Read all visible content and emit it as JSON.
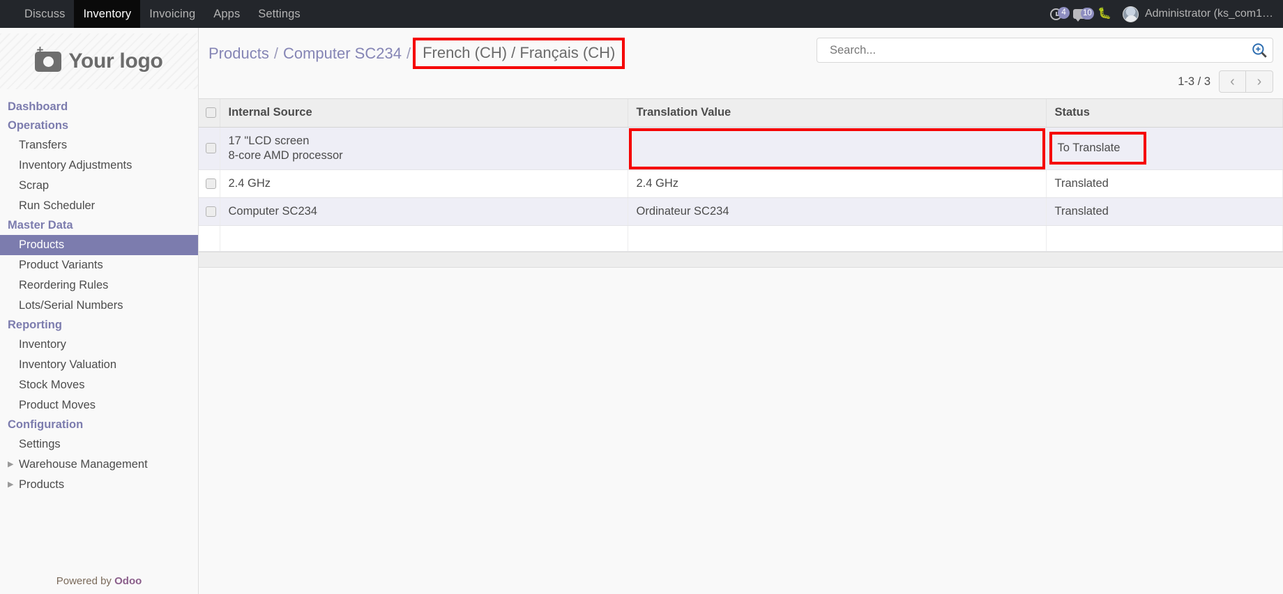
{
  "navbar": {
    "apps": [
      {
        "label": "Discuss",
        "active": false
      },
      {
        "label": "Inventory",
        "active": true
      },
      {
        "label": "Invoicing",
        "active": false
      },
      {
        "label": "Apps",
        "active": false
      },
      {
        "label": "Settings",
        "active": false
      }
    ],
    "activity_badge": "4",
    "messages_badge": "10",
    "debug_icon": "bug-icon",
    "user_name": "Administrator (ks_com1…"
  },
  "sidebar": {
    "logo_text": "Your logo",
    "logo_icon": "camera-add-icon",
    "items": [
      {
        "label": "Dashboard",
        "type": "section"
      },
      {
        "label": "Operations",
        "type": "section"
      },
      {
        "label": "Transfers",
        "type": "item"
      },
      {
        "label": "Inventory Adjustments",
        "type": "item"
      },
      {
        "label": "Scrap",
        "type": "item"
      },
      {
        "label": "Run Scheduler",
        "type": "item"
      },
      {
        "label": "Master Data",
        "type": "section"
      },
      {
        "label": "Products",
        "type": "item",
        "active": true
      },
      {
        "label": "Product Variants",
        "type": "item"
      },
      {
        "label": "Reordering Rules",
        "type": "item"
      },
      {
        "label": "Lots/Serial Numbers",
        "type": "item"
      },
      {
        "label": "Reporting",
        "type": "section"
      },
      {
        "label": "Inventory",
        "type": "item"
      },
      {
        "label": "Inventory Valuation",
        "type": "item"
      },
      {
        "label": "Stock Moves",
        "type": "item"
      },
      {
        "label": "Product Moves",
        "type": "item"
      },
      {
        "label": "Configuration",
        "type": "section"
      },
      {
        "label": "Settings",
        "type": "item"
      },
      {
        "label": "Warehouse Management",
        "type": "item",
        "caret": true
      },
      {
        "label": "Products",
        "type": "item",
        "caret": true
      }
    ],
    "footer_prefix": "Powered by",
    "footer_brand": "Odoo"
  },
  "breadcrumb": {
    "items": [
      {
        "label": "Products",
        "current": false
      },
      {
        "label": "Computer SC234",
        "current": false
      },
      {
        "label": "French (CH) / Français (CH)",
        "current": true
      }
    ],
    "separator": "/"
  },
  "search": {
    "value": "",
    "placeholder": "Search...",
    "icon": "search-zoom-icon"
  },
  "pager": {
    "count": "1-3 / 3",
    "prev": "‹",
    "next": "›"
  },
  "table": {
    "columns": [
      "Internal Source",
      "Translation Value",
      "Status"
    ],
    "rows": [
      {
        "internal_source_lines": [
          "17 \"LCD screen",
          "8-core AMD processor"
        ],
        "translation_value": "",
        "status": "To Translate",
        "highlight_translation": true,
        "highlight_status": true
      },
      {
        "internal_source_lines": [
          "2.4 GHz"
        ],
        "translation_value": "2.4 GHz",
        "status": "Translated",
        "highlight_translation": false,
        "highlight_status": false
      },
      {
        "internal_source_lines": [
          "Computer SC234"
        ],
        "translation_value": "Ordinateur SC234",
        "status": "Translated",
        "highlight_translation": false,
        "highlight_status": false
      }
    ]
  },
  "colors": {
    "navbar_bg": "#23262b",
    "accent_purple": "#7c7cae",
    "row_stripe": "#eeeef6",
    "annotation_red": "#f50000",
    "badge_bg": "#8e8ec0"
  }
}
